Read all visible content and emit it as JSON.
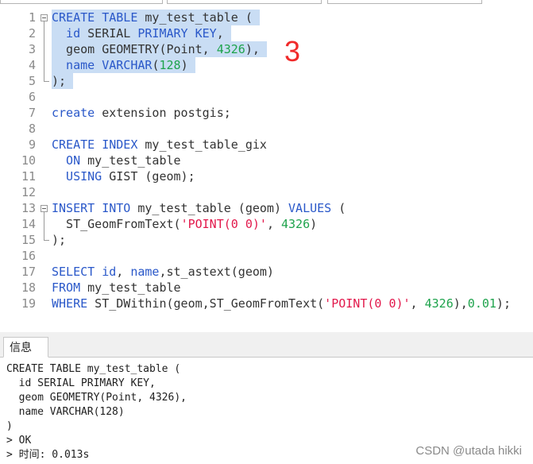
{
  "colors": {
    "text": "#333333",
    "keyword": "#2a58c9",
    "number": "#1ea34c",
    "string": "#e2184b",
    "line_number": "#8a8a8a",
    "selection": "#c9ddf4",
    "annotation": "#f02a2a"
  },
  "editor": {
    "lines": [
      {
        "n": "1",
        "fold": "fold-minus-icon",
        "selected": true,
        "tokens": [
          {
            "t": "CREATE TABLE",
            "c": "#2a58c9"
          },
          {
            "t": " my_test_table ("
          }
        ]
      },
      {
        "n": "2",
        "fold": "fold-line-icon",
        "selected": true,
        "tokens": [
          {
            "t": "  id",
            "c": "#2a58c9"
          },
          {
            "t": " SERIAL "
          },
          {
            "t": "PRIMARY KEY",
            "c": "#2a58c9"
          },
          {
            "t": ","
          }
        ]
      },
      {
        "n": "3",
        "fold": "fold-line-icon",
        "selected": true,
        "tokens": [
          {
            "t": "  geom GEOMETRY(Point, "
          },
          {
            "t": "4326",
            "c": "#1ea34c"
          },
          {
            "t": "),"
          }
        ]
      },
      {
        "n": "4",
        "fold": "fold-line-icon",
        "selected": true,
        "tokens": [
          {
            "t": "  name VARCHAR",
            "c": "#2a58c9"
          },
          {
            "t": "("
          },
          {
            "t": "128",
            "c": "#1ea34c"
          },
          {
            "t": ")"
          }
        ]
      },
      {
        "n": "5",
        "fold": "fold-end-icon",
        "selected": true,
        "tokens": [
          {
            "t": ");"
          }
        ]
      },
      {
        "n": "6",
        "tokens": []
      },
      {
        "n": "7",
        "tokens": [
          {
            "t": "create",
            "c": "#2a58c9"
          },
          {
            "t": " extension postgis;"
          }
        ]
      },
      {
        "n": "8",
        "tokens": []
      },
      {
        "n": "9",
        "tokens": [
          {
            "t": "CREATE INDEX",
            "c": "#2a58c9"
          },
          {
            "t": " my_test_table_gix"
          }
        ]
      },
      {
        "n": "10",
        "tokens": [
          {
            "t": "  ON",
            "c": "#2a58c9"
          },
          {
            "t": " my_test_table"
          }
        ]
      },
      {
        "n": "11",
        "tokens": [
          {
            "t": "  USING",
            "c": "#2a58c9"
          },
          {
            "t": " GIST (geom);"
          }
        ]
      },
      {
        "n": "12",
        "tokens": []
      },
      {
        "n": "13",
        "fold": "fold-minus-icon",
        "tokens": [
          {
            "t": "INSERT INTO",
            "c": "#2a58c9"
          },
          {
            "t": " my_test_table (geom) "
          },
          {
            "t": "VALUES",
            "c": "#2a58c9"
          },
          {
            "t": " ("
          }
        ]
      },
      {
        "n": "14",
        "fold": "fold-line-icon",
        "tokens": [
          {
            "t": "  ST_GeomFromText("
          },
          {
            "t": "'POINT(0 0)'",
            "c": "#e2184b"
          },
          {
            "t": ", "
          },
          {
            "t": "4326",
            "c": "#1ea34c"
          },
          {
            "t": ")"
          }
        ]
      },
      {
        "n": "15",
        "fold": "fold-end-icon",
        "tokens": [
          {
            "t": ");"
          }
        ]
      },
      {
        "n": "16",
        "tokens": []
      },
      {
        "n": "17",
        "tokens": [
          {
            "t": "SELECT id",
            "c": "#2a58c9"
          },
          {
            "t": ", "
          },
          {
            "t": "name",
            "c": "#2a58c9"
          },
          {
            "t": ",st_astext(geom)"
          }
        ]
      },
      {
        "n": "18",
        "tokens": [
          {
            "t": "FROM",
            "c": "#2a58c9"
          },
          {
            "t": " my_test_table"
          }
        ]
      },
      {
        "n": "19",
        "tokens": [
          {
            "t": "WHERE",
            "c": "#2a58c9"
          },
          {
            "t": " ST_DWithin(geom,ST_GeomFromText("
          },
          {
            "t": "'POINT(0 0)'",
            "c": "#e2184b"
          },
          {
            "t": ", "
          },
          {
            "t": "4326",
            "c": "#1ea34c"
          },
          {
            "t": "),"
          },
          {
            "t": "0.01",
            "c": "#1ea34c"
          },
          {
            "t": ");"
          }
        ]
      }
    ]
  },
  "annotation": "3",
  "output": {
    "tab_label": "信息",
    "lines": [
      "CREATE TABLE my_test_table (",
      "  id SERIAL PRIMARY KEY,",
      "  geom GEOMETRY(Point, 4326),",
      "  name VARCHAR(128)",
      ")",
      "> OK",
      "> 时间: 0.013s"
    ]
  },
  "watermark": "CSDN @utada hikki"
}
